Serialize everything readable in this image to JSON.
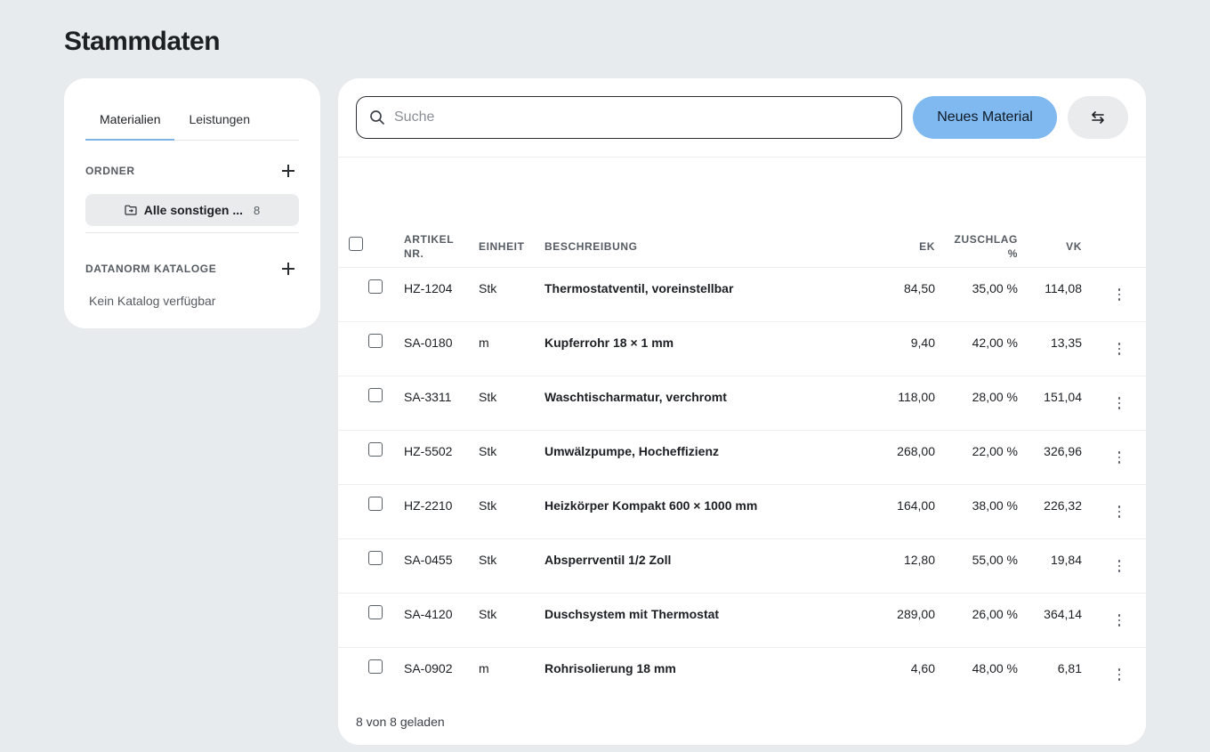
{
  "page": {
    "title": "Stammdaten"
  },
  "sidebar": {
    "tabs": [
      {
        "label": "Materialien",
        "active": true
      },
      {
        "label": "Leistungen",
        "active": false
      }
    ],
    "folders": {
      "label": "ORDNER",
      "items": [
        {
          "label": "Alle sonstigen ...",
          "count": "8"
        }
      ]
    },
    "catalogs": {
      "label": "DATANORM KATALOGE",
      "empty_text": "Kein Katalog verfügbar"
    }
  },
  "toolbar": {
    "search_placeholder": "Suche",
    "search_value": "",
    "primary_label": "Neues Material",
    "primary_color": "#7fb9ef"
  },
  "table": {
    "headers": {
      "artikel_line1": "ARTIKEL",
      "artikel_line2": "NR.",
      "einheit": "EINHEIT",
      "beschreibung": "BESCHREIBUNG",
      "ek": "EK",
      "zuschlag_line1": "ZUSCHLAG",
      "zuschlag_line2": "%",
      "vk": "VK"
    },
    "rows": [
      {
        "artikel": "HZ-1204",
        "einheit": "Stk",
        "beschreibung": "Thermostatventil, voreinstellbar",
        "ek": "84,50",
        "zuschlag": "35,00 %",
        "vk": "114,08"
      },
      {
        "artikel": "SA-0180",
        "einheit": "m",
        "beschreibung": "Kupferrohr 18 × 1 mm",
        "ek": "9,40",
        "zuschlag": "42,00 %",
        "vk": "13,35"
      },
      {
        "artikel": "SA-3311",
        "einheit": "Stk",
        "beschreibung": "Waschtischarmatur, verchromt",
        "ek": "118,00",
        "zuschlag": "28,00 %",
        "vk": "151,04"
      },
      {
        "artikel": "HZ-5502",
        "einheit": "Stk",
        "beschreibung": "Umwälzpumpe, Hocheffizienz",
        "ek": "268,00",
        "zuschlag": "22,00 %",
        "vk": "326,96"
      },
      {
        "artikel": "HZ-2210",
        "einheit": "Stk",
        "beschreibung": "Heizkörper Kompakt 600 × 1000 mm",
        "ek": "164,00",
        "zuschlag": "38,00 %",
        "vk": "226,32"
      },
      {
        "artikel": "SA-0455",
        "einheit": "Stk",
        "beschreibung": "Absperrventil 1/2 Zoll",
        "ek": "12,80",
        "zuschlag": "55,00 %",
        "vk": "19,84"
      },
      {
        "artikel": "SA-4120",
        "einheit": "Stk",
        "beschreibung": "Duschsystem mit Thermostat",
        "ek": "289,00",
        "zuschlag": "26,00 %",
        "vk": "364,14"
      },
      {
        "artikel": "SA-0902",
        "einheit": "m",
        "beschreibung": "Rohrisolierung 18 mm",
        "ek": "4,60",
        "zuschlag": "48,00 %",
        "vk": "6,81"
      }
    ],
    "footer": "8 von 8 geladen"
  },
  "icons": {
    "search": "search-icon",
    "folder": "folder-icon",
    "plus": "plus-icon",
    "swap": "swap-arrows-icon",
    "row_menu": "more-vertical-icon"
  }
}
